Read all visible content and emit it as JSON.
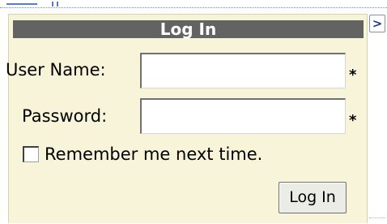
{
  "login": {
    "title": "Log In",
    "username_label": "User Name:",
    "username_value": "",
    "password_label": "Password:",
    "password_value": "",
    "required_marker": "*",
    "remember_label": "Remember me next time.",
    "remember_checked": false,
    "submit_label": "Log In"
  },
  "collapse_glyph": ">",
  "icons": [
    "collapse-arrow-icon"
  ],
  "colors": {
    "panel_bg": "#f7f4d9",
    "title_bar": "#636363",
    "title_text": "#ffffff"
  }
}
